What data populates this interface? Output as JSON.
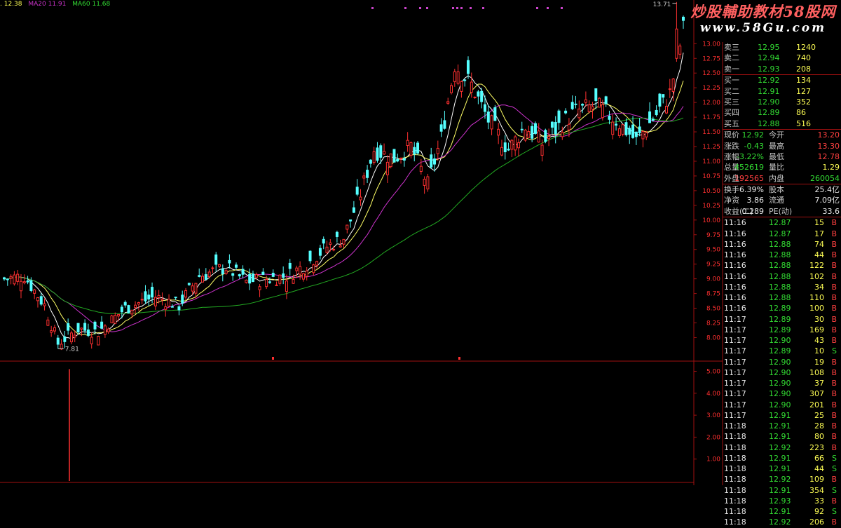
{
  "legend": {
    "ma5_label": ". 12.38",
    "ma20_label": "MA20  11.91",
    "ma60_label": "MA60  11.68"
  },
  "watermark": {
    "line1": "炒股輔助教材58股网",
    "line2": "www.58Gu.com"
  },
  "annotations": {
    "high": "13.71",
    "low": "7.81"
  },
  "colors": {
    "up": "#ff3030",
    "down": "#55ffff",
    "ma5": "#ffffff",
    "ma10": "#ffff66",
    "ma20": "#cc33cc",
    "ma60": "#22aa22",
    "border": "#a01010",
    "axis_text": "#ff3030"
  },
  "quote": {
    "asks": [
      {
        "label": "卖三",
        "price": "12.95",
        "vol": "1240"
      },
      {
        "label": "卖二",
        "price": "12.94",
        "vol": "740"
      },
      {
        "label": "卖一",
        "price": "12.93",
        "vol": "208"
      }
    ],
    "bids": [
      {
        "label": "买一",
        "price": "12.92",
        "vol": "134"
      },
      {
        "label": "买二",
        "price": "12.91",
        "vol": "127"
      },
      {
        "label": "买三",
        "price": "12.90",
        "vol": "352"
      },
      {
        "label": "买四",
        "price": "12.89",
        "vol": "86"
      },
      {
        "label": "买五",
        "price": "12.88",
        "vol": "516"
      }
    ],
    "stats": [
      {
        "l1": "现价",
        "v1": "12.92",
        "l2": "今开",
        "v2": "13.20"
      },
      {
        "l1": "涨跌",
        "v1": "-0.43",
        "l2": "最高",
        "v2": "13.30"
      },
      {
        "l1": "涨幅",
        "v1": "-3.22%",
        "l2": "最低",
        "v2": "12.78"
      },
      {
        "l1": "总量",
        "v1": "452619",
        "l2": "量比",
        "v2": "1.29"
      },
      {
        "l1": "外盘",
        "v1": "192565",
        "l2": "内盘",
        "v2": "260054"
      }
    ],
    "info": [
      {
        "l1": "换手",
        "v1": "6.39%",
        "l2": "股本",
        "v2": "25.4亿"
      },
      {
        "l1": "净资",
        "v1": "3.86",
        "l2": "流通",
        "v2": "7.09亿"
      },
      {
        "l1": "收益(二)",
        "v1": "0.289",
        "l2": "PE(动)",
        "v2": "33.6"
      }
    ]
  },
  "ticks": [
    {
      "t": "11:16",
      "p": "12.87",
      "v": "15",
      "d": "B"
    },
    {
      "t": "11:16",
      "p": "12.87",
      "v": "17",
      "d": "B"
    },
    {
      "t": "11:16",
      "p": "12.88",
      "v": "74",
      "d": "B"
    },
    {
      "t": "11:16",
      "p": "12.88",
      "v": "44",
      "d": "B"
    },
    {
      "t": "11:16",
      "p": "12.88",
      "v": "122",
      "d": "B"
    },
    {
      "t": "11:16",
      "p": "12.88",
      "v": "102",
      "d": "B"
    },
    {
      "t": "11:16",
      "p": "12.88",
      "v": "34",
      "d": "B"
    },
    {
      "t": "11:16",
      "p": "12.88",
      "v": "110",
      "d": "B"
    },
    {
      "t": "11:16",
      "p": "12.89",
      "v": "100",
      "d": "B"
    },
    {
      "t": "11:17",
      "p": "12.89",
      "v": "30",
      "d": "B"
    },
    {
      "t": "11:17",
      "p": "12.89",
      "v": "169",
      "d": "B"
    },
    {
      "t": "11:17",
      "p": "12.90",
      "v": "43",
      "d": "B"
    },
    {
      "t": "11:17",
      "p": "12.89",
      "v": "10",
      "d": "S"
    },
    {
      "t": "11:17",
      "p": "12.90",
      "v": "19",
      "d": "B"
    },
    {
      "t": "11:17",
      "p": "12.90",
      "v": "108",
      "d": "B"
    },
    {
      "t": "11:17",
      "p": "12.90",
      "v": "37",
      "d": "B"
    },
    {
      "t": "11:17",
      "p": "12.90",
      "v": "307",
      "d": "B"
    },
    {
      "t": "11:17",
      "p": "12.90",
      "v": "201",
      "d": "B"
    },
    {
      "t": "11:17",
      "p": "12.91",
      "v": "25",
      "d": "B"
    },
    {
      "t": "11:18",
      "p": "12.91",
      "v": "28",
      "d": "B"
    },
    {
      "t": "11:18",
      "p": "12.91",
      "v": "80",
      "d": "B"
    },
    {
      "t": "11:18",
      "p": "12.92",
      "v": "223",
      "d": "B"
    },
    {
      "t": "11:18",
      "p": "12.91",
      "v": "66",
      "d": "S"
    },
    {
      "t": "11:18",
      "p": "12.91",
      "v": "44",
      "d": "S"
    },
    {
      "t": "11:18",
      "p": "12.92",
      "v": "109",
      "d": "B"
    },
    {
      "t": "11:18",
      "p": "12.91",
      "v": "354",
      "d": "S"
    },
    {
      "t": "11:18",
      "p": "12.93",
      "v": "33",
      "d": "B"
    },
    {
      "t": "11:18",
      "p": "12.91",
      "v": "92",
      "d": "S"
    },
    {
      "t": "11:18",
      "p": "12.92",
      "v": "206",
      "d": "B"
    }
  ],
  "chart_data": {
    "type": "candlestick",
    "title": "",
    "price_axis": {
      "ticks": [
        13.0,
        12.75,
        12.5,
        12.25,
        12.0,
        11.75,
        11.5,
        11.25,
        11.0,
        10.75,
        10.5,
        10.25,
        10.0,
        9.75,
        9.5,
        9.25,
        9.0,
        8.75,
        8.5,
        8.25,
        8.0
      ],
      "ylim": [
        7.6,
        13.6
      ],
      "labels": [
        "13.00",
        "12.75",
        "12.50",
        "12.25",
        "12.00",
        "11.75",
        "11.50",
        "11.25",
        "11.00",
        "10.75",
        "10.50",
        "10.25",
        "10.00",
        "9.75",
        "9.50",
        "9.25",
        "9.00",
        "8.75",
        "8.50",
        "8.25",
        "8.00"
      ]
    },
    "volume_axis": {
      "ticks": [
        5.0,
        4.0,
        3.0,
        2.0,
        1.0
      ],
      "labels": [
        "5.00",
        "4.00",
        "3.00",
        "2.00",
        "1.00"
      ],
      "ylim": [
        0,
        5.4
      ]
    },
    "highest": 13.71,
    "lowest": 7.81,
    "anchors": [
      [
        0,
        9.0
      ],
      [
        6,
        9.05
      ],
      [
        12,
        8.55
      ],
      [
        16,
        7.9
      ],
      [
        22,
        8.15
      ],
      [
        28,
        8.1
      ],
      [
        36,
        8.5
      ],
      [
        45,
        8.7
      ],
      [
        52,
        8.55
      ],
      [
        58,
        9.05
      ],
      [
        66,
        9.2
      ],
      [
        72,
        8.95
      ],
      [
        78,
        9.0
      ],
      [
        84,
        9.05
      ],
      [
        90,
        9.25
      ],
      [
        96,
        9.55
      ],
      [
        101,
        9.7
      ],
      [
        106,
        10.45
      ],
      [
        110,
        11.2
      ],
      [
        116,
        11.05
      ],
      [
        121,
        11.25
      ],
      [
        126,
        10.6
      ],
      [
        130,
        11.4
      ],
      [
        134,
        12.65
      ],
      [
        139,
        12.3
      ],
      [
        144,
        11.7
      ],
      [
        150,
        11.2
      ],
      [
        155,
        11.6
      ],
      [
        160,
        11.3
      ],
      [
        165,
        11.6
      ],
      [
        170,
        11.85
      ],
      [
        176,
        11.95
      ],
      [
        182,
        11.7
      ],
      [
        188,
        11.35
      ],
      [
        194,
        11.8
      ],
      [
        198,
        12.15
      ],
      [
        202,
        13.25
      ]
    ],
    "candle_count": 203,
    "ma_periods": [
      5,
      10,
      20,
      60
    ],
    "volume_spike_index": 22,
    "volume_spike_value": 5.1
  }
}
